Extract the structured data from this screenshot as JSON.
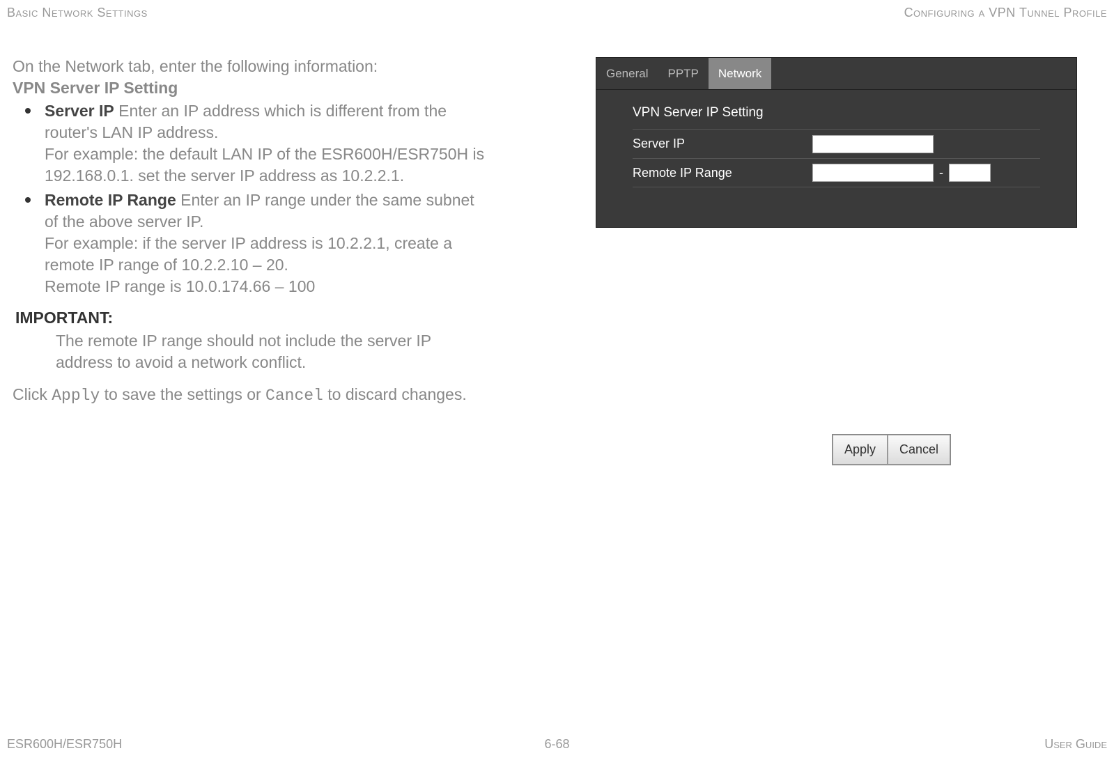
{
  "header": {
    "left": "Basic Network Settings",
    "right": "Configuring a VPN Tunnel Profile"
  },
  "body": {
    "intro": "On the Network tab, enter the following information:",
    "section_title": "VPN Server IP Setting",
    "items": [
      {
        "term": "Server IP",
        "desc": "  Enter an IP address which is different from the router's LAN IP address.",
        "example": "For example: the default LAN IP of the ESR600H/ESR750H is 192.168.0.1. set the server IP address as 10.2.2.1."
      },
      {
        "term": "Remote IP Range",
        "desc": "  Enter an IP range under the same subnet of the above server IP.",
        "example": "For example: if the server IP address is 10.2.2.1, create a remote IP range of 10.2.2.10 – 20.",
        "extra": "Remote IP range is 10.0.174.66 – 100"
      }
    ],
    "important_label": "IMPORTANT:",
    "important_body": "The remote IP range should not include the server IP address to avoid a network conflict.",
    "click_pre": "Click ",
    "click_apply": "Apply",
    "click_mid": " to save the settings or ",
    "click_cancel": "Cancel",
    "click_post": " to discard changes."
  },
  "screenshot": {
    "tabs": [
      "General",
      "PPTP",
      "Network"
    ],
    "active_tab_index": 2,
    "section": "VPN Server IP Setting",
    "rows": [
      {
        "label": "Server IP"
      },
      {
        "label": "Remote IP Range"
      }
    ],
    "dash": "-"
  },
  "buttons": {
    "apply": "Apply",
    "cancel": "Cancel"
  },
  "footer": {
    "left": "ESR600H/ESR750H",
    "center": "6-68",
    "right": "User Guide"
  }
}
